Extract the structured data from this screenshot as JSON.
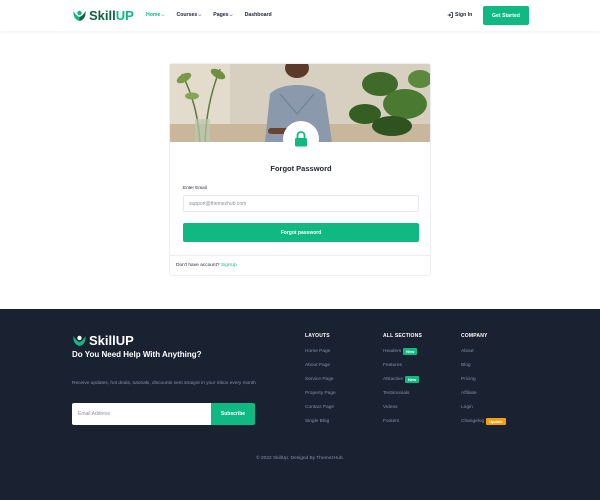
{
  "brand": {
    "name_part1": "Skill",
    "name_part2": "UP",
    "accent": "#10b981",
    "dark": "#1a2131"
  },
  "nav": {
    "items": [
      {
        "label": "Home",
        "dropdown": true,
        "active": true
      },
      {
        "label": "Courses",
        "dropdown": true,
        "active": false
      },
      {
        "label": "Pages",
        "dropdown": true,
        "active": false
      },
      {
        "label": "Dashboard",
        "dropdown": false,
        "active": false
      }
    ],
    "signin_label": "Sign In",
    "cta_label": "Get Started"
  },
  "card": {
    "title": "Forgot Password",
    "field_label": "Enter Email",
    "field_placeholder": "support@themezhub.com",
    "submit_label": "Forgot password",
    "footer_text": "Don't have account?",
    "footer_link": "SignUp"
  },
  "footer": {
    "brand": {
      "name": "SkillUP"
    },
    "heading": "Do You Need Help With Anything?",
    "description": "Receive updates, hot deals, tutorials, discounts sent straignt in your inbox every month",
    "email_placeholder": "Email Address",
    "subscribe_label": "Subscribe",
    "columns": [
      {
        "title": "LAYOUTS",
        "items": [
          {
            "label": "Home Page"
          },
          {
            "label": "About Page"
          },
          {
            "label": "Service Page"
          },
          {
            "label": "Property Page"
          },
          {
            "label": "Contact Page"
          },
          {
            "label": "Single Blog"
          }
        ]
      },
      {
        "title": "ALL SECTIONS",
        "items": [
          {
            "label": "Headers",
            "badge": "New",
            "badge_color": "#10b981"
          },
          {
            "label": "Features"
          },
          {
            "label": "Attractive",
            "badge": "New",
            "badge_color": "#10b981"
          },
          {
            "label": "Testimonials"
          },
          {
            "label": "Videos"
          },
          {
            "label": "Footers"
          }
        ]
      },
      {
        "title": "COMPANY",
        "items": [
          {
            "label": "About"
          },
          {
            "label": "Blog"
          },
          {
            "label": "Pricing"
          },
          {
            "label": "Affiliate"
          },
          {
            "label": "Login"
          },
          {
            "label": "Changelog",
            "badge": "Update",
            "badge_color": "#f59e0b"
          }
        ]
      }
    ],
    "copyright": "© 2022 SkillUp. Designd By ThemezHub."
  }
}
